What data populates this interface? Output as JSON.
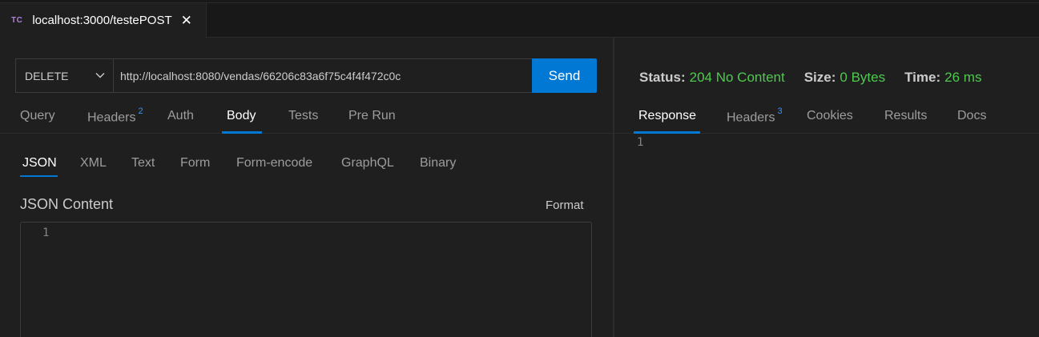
{
  "tab": {
    "icon_text": "TC",
    "title": "localhost:3000/testePOST",
    "close_glyph": "✕"
  },
  "request": {
    "method": "DELETE",
    "url": "http://localhost:8080/vendas/66206c83a6f75c4f4f472c0c",
    "send_label": "Send"
  },
  "request_tabs": [
    {
      "label": "Query",
      "badge": ""
    },
    {
      "label": "Headers",
      "badge": "2"
    },
    {
      "label": "Auth",
      "badge": ""
    },
    {
      "label": "Body",
      "badge": "",
      "active": true
    },
    {
      "label": "Tests",
      "badge": ""
    },
    {
      "label": "Pre Run",
      "badge": ""
    }
  ],
  "body_tabs": [
    {
      "label": "JSON",
      "active": true
    },
    {
      "label": "XML"
    },
    {
      "label": "Text"
    },
    {
      "label": "Form"
    },
    {
      "label": "Form-encode"
    },
    {
      "label": "GraphQL"
    },
    {
      "label": "Binary"
    }
  ],
  "json_content": {
    "label": "JSON Content",
    "format_label": "Format",
    "line_number": "1"
  },
  "response": {
    "status_label": "Status:",
    "status_value": "204 No Content",
    "size_label": "Size:",
    "size_value": "0 Bytes",
    "time_label": "Time:",
    "time_value": "26 ms",
    "line_number": "1"
  },
  "response_tabs": [
    {
      "label": "Response",
      "badge": "",
      "active": true
    },
    {
      "label": "Headers",
      "badge": "3"
    },
    {
      "label": "Cookies",
      "badge": ""
    },
    {
      "label": "Results",
      "badge": ""
    },
    {
      "label": "Docs",
      "badge": ""
    }
  ],
  "colors": {
    "accent": "#0078d4",
    "success": "#4ec94e",
    "badge": "#3794ff",
    "tc_icon": "#b180d7"
  }
}
